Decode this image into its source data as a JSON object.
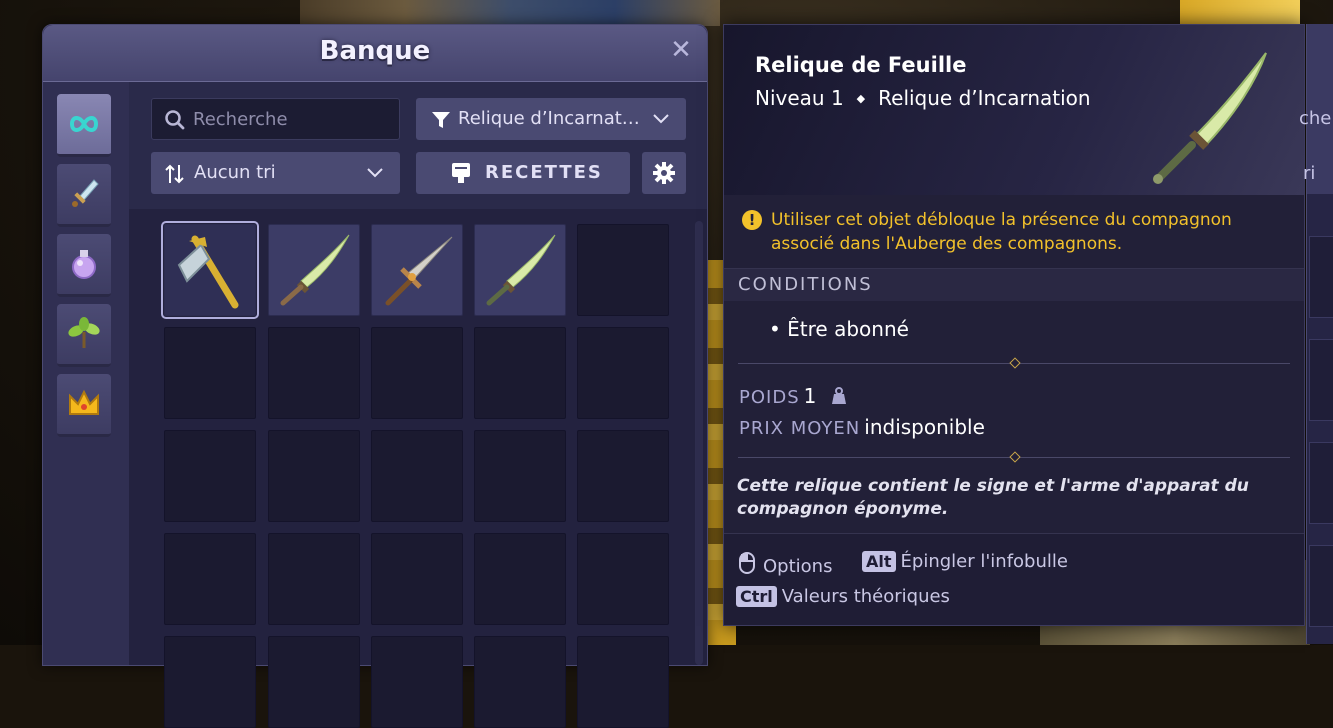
{
  "bank": {
    "title": "Banque",
    "close_symbol": "✕",
    "search_placeholder": "Recherche",
    "filter_label": "Relique d’Incarnat…",
    "sort_label": "Aucun tri",
    "recipes_label": "RECETTES",
    "tabs": [
      "all-items-icon",
      "equipment-icon",
      "consumables-icon",
      "resources-icon",
      "cosmetic-crown-icon"
    ],
    "items": [
      {
        "name": "pickaxe-item-icon",
        "selected": true
      },
      {
        "name": "leaf-sword-item-icon",
        "selected": false
      },
      {
        "name": "dagger-item-icon",
        "selected": false
      },
      {
        "name": "leaf-sword-item-icon",
        "selected": false
      }
    ]
  },
  "tooltip": {
    "name": "Relique de Feuille",
    "level": "Niveau 1",
    "category": "Relique d’Incarnation",
    "warning": "Utiliser cet objet débloque la présence du compagnon associé dans l'Auberge des compagnons.",
    "conditions_label": "CONDITIONS",
    "condition_item": "• Être abonné",
    "weight_label": "POIDS",
    "weight_value": "1",
    "price_label": "PRIX MOYEN",
    "price_value": "indisponible",
    "description": "Cette relique contient le signe et l'arme d'apparat du compagnon éponyme.",
    "hints": {
      "options": "Options",
      "alt_key": "Alt",
      "pin": "Épingler l'infobulle",
      "ctrl_key": "Ctrl",
      "theoretical": "Valeurs théoriques"
    }
  },
  "right_panel": {
    "partial_text_1": "che",
    "partial_text_2": "ri"
  },
  "colors": {
    "warning": "#f2c12b",
    "panel": "#262545",
    "header": "#5a5984"
  }
}
